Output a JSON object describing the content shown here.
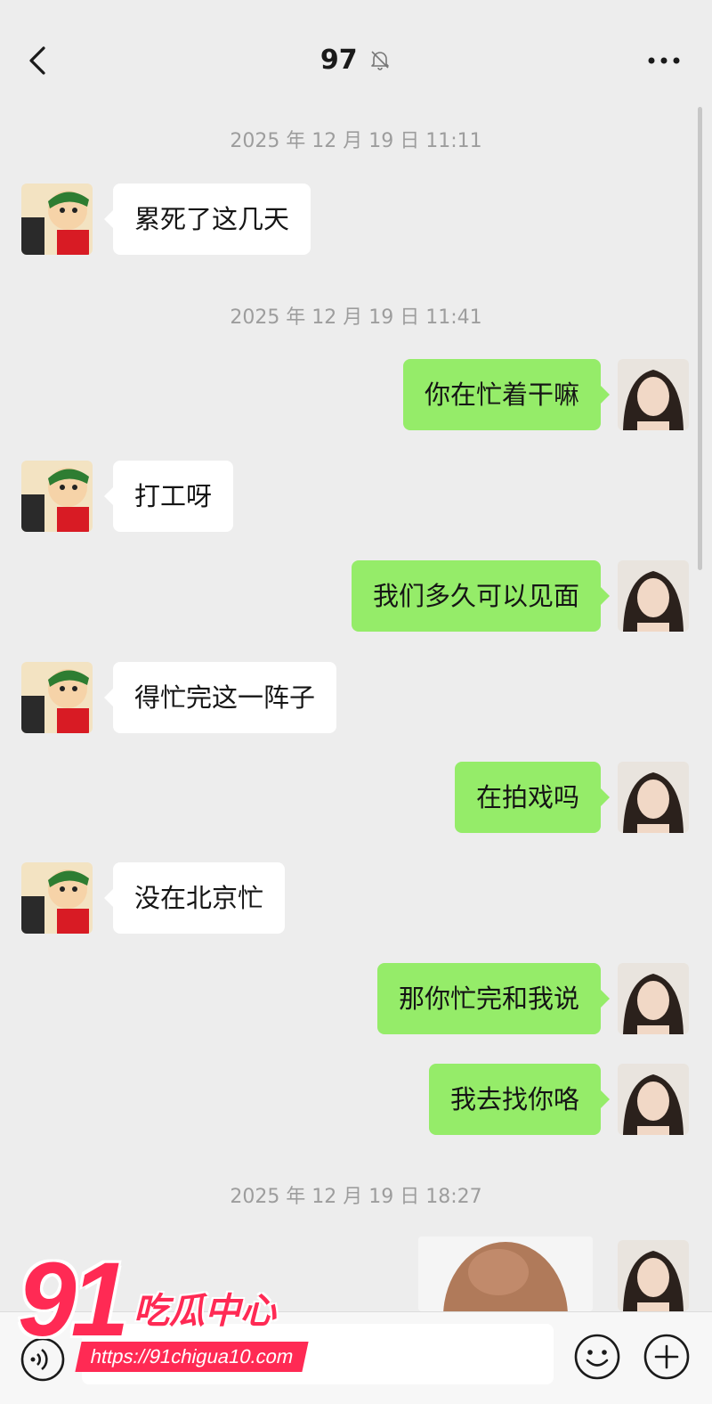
{
  "header": {
    "title": "97",
    "mute_icon": "bell-off-icon",
    "back_icon": "chevron-left-icon",
    "more_icon": "ellipsis-icon"
  },
  "timestamps": [
    "2025 年 12 月 19 日 11:11",
    "2025 年 12 月 19 日 11:41",
    "2025 年 12 月 19 日 18:27"
  ],
  "messages": [
    {
      "side": "in",
      "text": "累死了这几天"
    },
    {
      "side": "out",
      "text": "你在忙着干嘛"
    },
    {
      "side": "in",
      "text": "打工呀"
    },
    {
      "side": "out",
      "text": "我们多久可以见面"
    },
    {
      "side": "in",
      "text": "得忙完这一阵子"
    },
    {
      "side": "out",
      "text": "在拍戏吗"
    },
    {
      "side": "in",
      "text": "没在北京忙"
    },
    {
      "side": "out",
      "text": "那你忙完和我说"
    },
    {
      "side": "out",
      "text": "我去找你咯"
    }
  ],
  "colors": {
    "background": "#ededed",
    "outgoing_bubble": "#95ec69",
    "incoming_bubble": "#ffffff",
    "timestamp": "#9d9d9d",
    "watermark": "#ff2a54"
  },
  "bottombar": {
    "voice_icon": "voice-icon",
    "emoji_icon": "emoji-icon",
    "plus_icon": "plus-icon"
  },
  "watermark": {
    "number": "91",
    "name": "吃瓜中心",
    "url": "https://91chigua10.com"
  }
}
